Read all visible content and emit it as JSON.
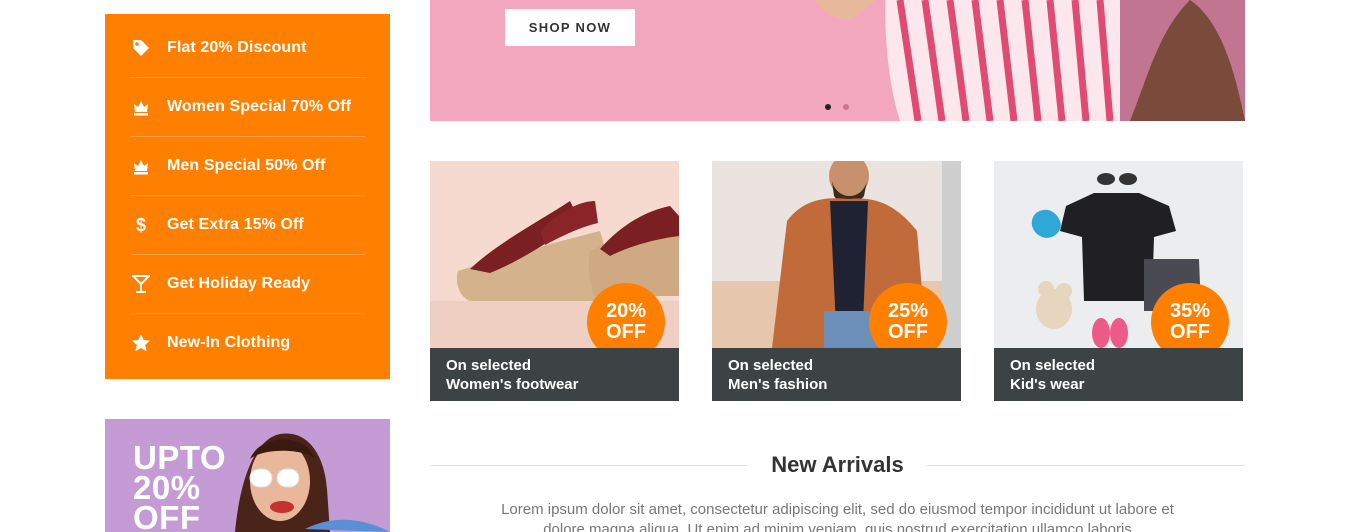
{
  "promo_menu": {
    "items": [
      {
        "label": "Flat 20% Discount",
        "icon": "tag-icon"
      },
      {
        "label": "Women Special 70% Off",
        "icon": "crown-icon"
      },
      {
        "label": "Men Special 50% Off",
        "icon": "crown-icon"
      },
      {
        "label": "Get Extra 15% Off",
        "icon": "dollar-icon"
      },
      {
        "label": "Get Holiday Ready",
        "icon": "cocktail-icon"
      },
      {
        "label": "New-In Clothing",
        "icon": "star-icon"
      }
    ]
  },
  "hero": {
    "shop_now_label": "SHOP NOW",
    "slides_total": 2,
    "active_slide": 1
  },
  "side_banner": {
    "line1": "UPTO",
    "line2": "20%",
    "line3": "OFF"
  },
  "cards": [
    {
      "pct": "20%",
      "off": "OFF",
      "line1": "On selected",
      "line2": "Women's footwear"
    },
    {
      "pct": "25%",
      "off": "OFF",
      "line1": "On selected",
      "line2": "Men's fashion"
    },
    {
      "pct": "35%",
      "off": "OFF",
      "line1": "On selected",
      "line2": "Kid's wear"
    }
  ],
  "new_arrivals": {
    "title": "New Arrivals",
    "description": "Lorem ipsum dolor sit amet, consectetur adipiscing elit, sed do eiusmod tempor incididunt ut labore et dolore magna aliqua. Ut enim ad minim veniam, quis nostrud exercitation ullamco laboris"
  },
  "colors": {
    "accent": "#ff7f00",
    "caption_bg": "#3d4345",
    "hero_bg": "#f3a7bf",
    "side_banner_bg": "#c49bd4"
  }
}
